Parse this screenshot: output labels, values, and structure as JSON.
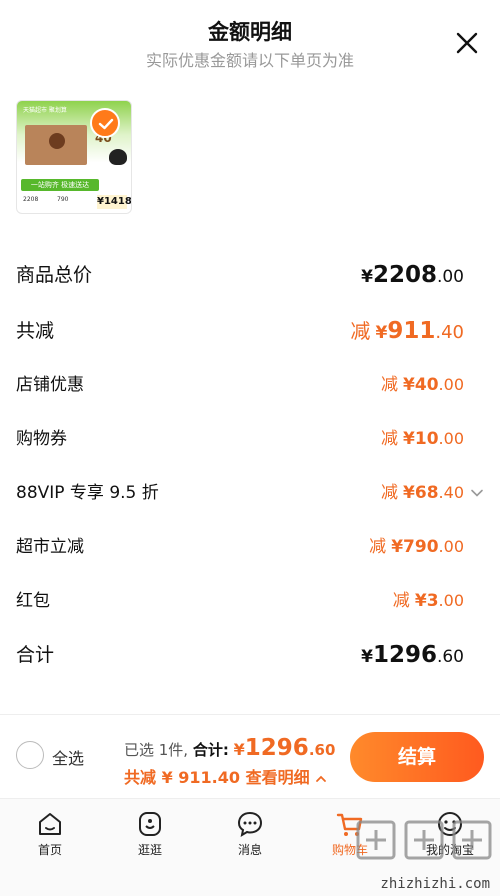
{
  "header": {
    "title": "金额明细",
    "subtitle": "实际优惠金额请以下单页为准"
  },
  "product": {
    "thumb_store": "天猫超市 聚划算",
    "thumb_number": "40",
    "thumb_strip": "一站购齐 极速送达",
    "thumb_p1": "2208",
    "thumb_p2": "790",
    "thumb_price": "¥1418"
  },
  "rows": [
    {
      "label": "商品总价",
      "prefix": "",
      "yen": "¥",
      "int": "2208",
      "dec": ".00"
    },
    {
      "label": "共减",
      "prefix": "减",
      "yen": "¥",
      "int": "911",
      "dec": ".40"
    },
    {
      "label": "店铺优惠",
      "prefix": "减",
      "yen": "¥",
      "int": "40",
      "dec": ".00"
    },
    {
      "label": "购物券",
      "prefix": "减",
      "yen": "¥",
      "int": "10",
      "dec": ".00"
    },
    {
      "label": "88VIP 专享 9.5 折",
      "prefix": "减",
      "yen": "¥",
      "int": "68",
      "dec": ".40"
    },
    {
      "label": "超市立减",
      "prefix": "减",
      "yen": "¥",
      "int": "790",
      "dec": ".00"
    },
    {
      "label": "红包",
      "prefix": "减",
      "yen": "¥",
      "int": "3",
      "dec": ".00"
    },
    {
      "label": "合计",
      "prefix": "",
      "yen": "¥",
      "int": "1296",
      "dec": ".60"
    }
  ],
  "bottom_bar": {
    "select_all": "全选",
    "selected": "已选 1件,",
    "total_label": "合计:",
    "total_yen": "¥",
    "total_int": "1296",
    "total_dec": ".60",
    "savings_label": "共减 ¥ 911.40",
    "view_detail": "查看明细",
    "checkout": "结算"
  },
  "tabs": [
    {
      "label": "首页",
      "icon": "home-icon"
    },
    {
      "label": "逛逛",
      "icon": "browse-icon"
    },
    {
      "label": "消息",
      "icon": "message-icon"
    },
    {
      "label": "购物车",
      "icon": "cart-icon"
    },
    {
      "label": "我的淘宝",
      "icon": "profile-icon"
    }
  ],
  "watermark": "zhizhizhi.com",
  "colors": {
    "accent": "#f06a23",
    "text": "#111111",
    "muted": "#999999"
  }
}
